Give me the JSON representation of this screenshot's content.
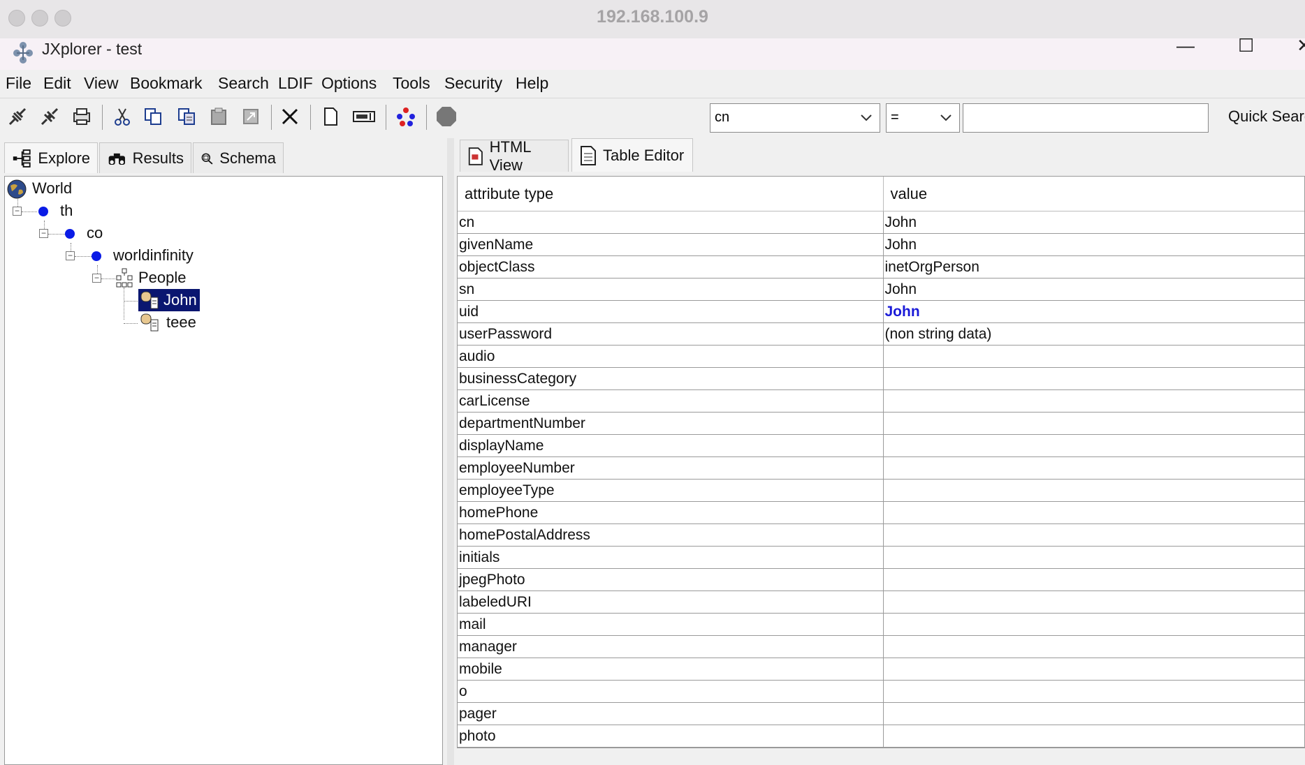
{
  "mac": {
    "title": "192.168.100.9"
  },
  "window": {
    "title": "JXplorer - test"
  },
  "menu": [
    "File",
    "Edit",
    "View",
    "Bookmark",
    "Search",
    "LDIF",
    "Options",
    "Tools",
    "Security",
    "Help"
  ],
  "search": {
    "attribute": "cn",
    "operator": "=",
    "value": "",
    "button_label": "Quick Search"
  },
  "left_tabs": {
    "explore": "Explore",
    "results": "Results",
    "schema": "Schema"
  },
  "tree": {
    "world": "World",
    "th": "th",
    "co": "co",
    "worldinfinity": "worldinfinity",
    "people": "People",
    "john": "John",
    "teee": "teee"
  },
  "right_tabs": {
    "html_view": "HTML View",
    "table_editor": "Table Editor"
  },
  "table": {
    "headers": {
      "attribute": "attribute type",
      "value": "value"
    },
    "rows": [
      {
        "attr": "cn",
        "value": "John"
      },
      {
        "attr": "givenName",
        "value": "John"
      },
      {
        "attr": "objectClass",
        "value": "inetOrgPerson"
      },
      {
        "attr": "sn",
        "value": "John"
      },
      {
        "attr": "uid",
        "value": "John"
      },
      {
        "attr": "userPassword",
        "value": "(non string data)"
      },
      {
        "attr": "audio",
        "value": ""
      },
      {
        "attr": "businessCategory",
        "value": ""
      },
      {
        "attr": "carLicense",
        "value": ""
      },
      {
        "attr": "departmentNumber",
        "value": ""
      },
      {
        "attr": "displayName",
        "value": ""
      },
      {
        "attr": "employeeNumber",
        "value": ""
      },
      {
        "attr": "employeeType",
        "value": ""
      },
      {
        "attr": "homePhone",
        "value": ""
      },
      {
        "attr": "homePostalAddress",
        "value": ""
      },
      {
        "attr": "initials",
        "value": ""
      },
      {
        "attr": "jpegPhoto",
        "value": ""
      },
      {
        "attr": "labeledURI",
        "value": ""
      },
      {
        "attr": "mail",
        "value": ""
      },
      {
        "attr": "manager",
        "value": ""
      },
      {
        "attr": "mobile",
        "value": ""
      },
      {
        "attr": "o",
        "value": ""
      },
      {
        "attr": "pager",
        "value": ""
      },
      {
        "attr": "photo",
        "value": ""
      }
    ]
  },
  "colors": {
    "selection": "#0a1670",
    "bullet": "#0a1be6",
    "bold_value": "#1a1ad8"
  }
}
